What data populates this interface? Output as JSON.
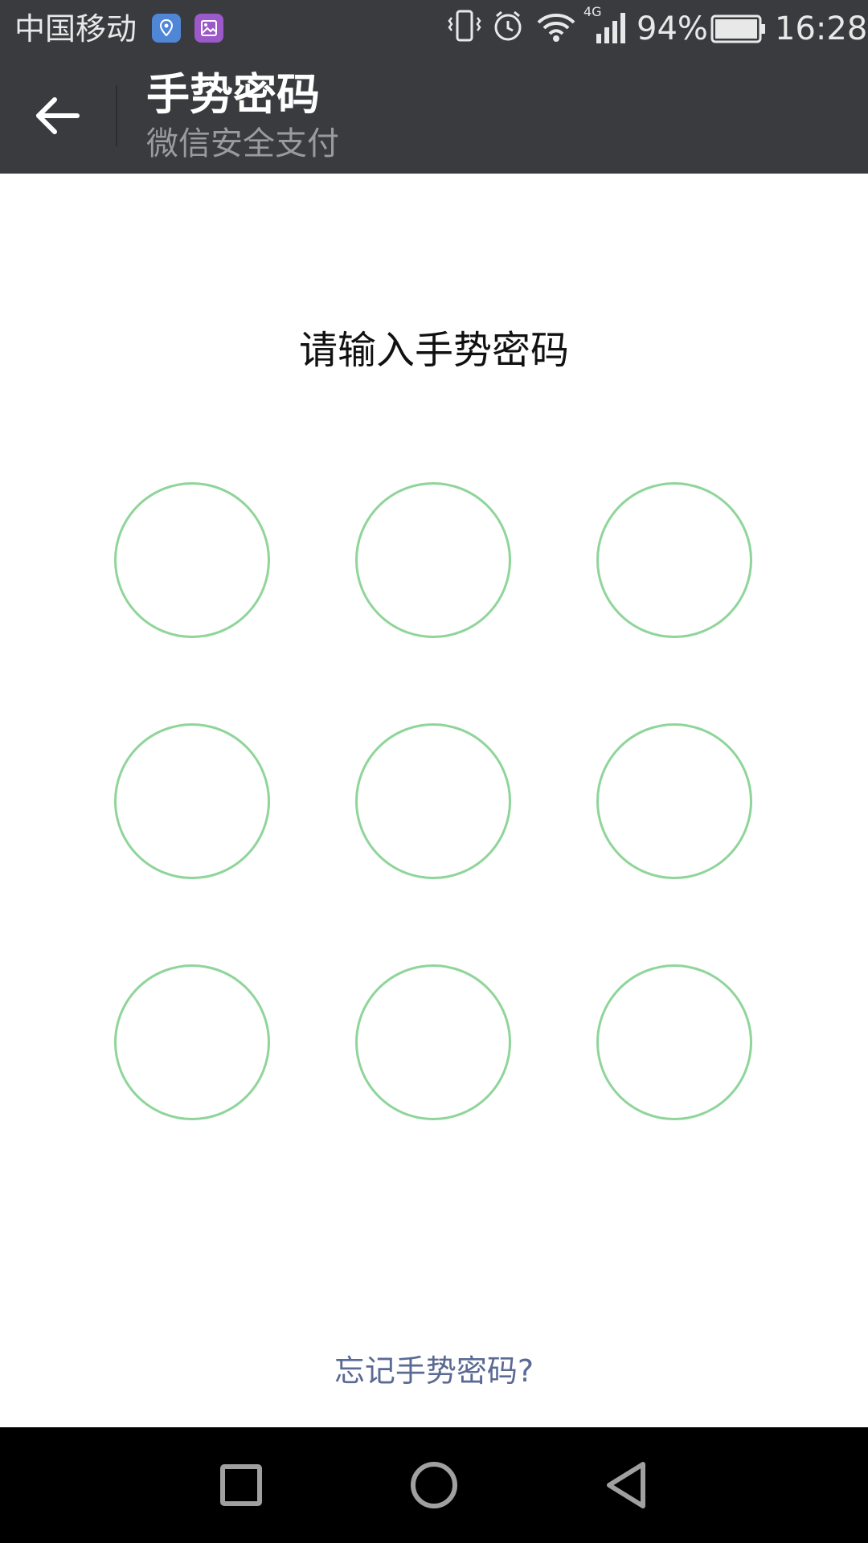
{
  "status_bar": {
    "carrier": "中国移动",
    "network": "4G",
    "battery": "94%",
    "time": "16:28",
    "icons": [
      "location-notification-icon",
      "gallery-notification-icon",
      "vibrate-icon",
      "alarm-icon",
      "wifi-icon",
      "signal-icon",
      "battery-icon"
    ]
  },
  "app_bar": {
    "title": "手势密码",
    "subtitle": "微信安全支付",
    "back_icon": "arrow-left-icon"
  },
  "main": {
    "prompt": "请输入手势密码",
    "forgot_link": "忘记手势密码?",
    "pattern_dots": [
      1,
      2,
      3,
      4,
      5,
      6,
      7,
      8,
      9
    ]
  },
  "nav_bar": {
    "buttons": [
      "recent-apps-icon",
      "home-icon",
      "back-icon"
    ]
  },
  "colors": {
    "bar_background": "#3a3b3f",
    "dot_ring": "#8fd59a",
    "link": "#5b6a93",
    "nav_background": "#000000"
  }
}
